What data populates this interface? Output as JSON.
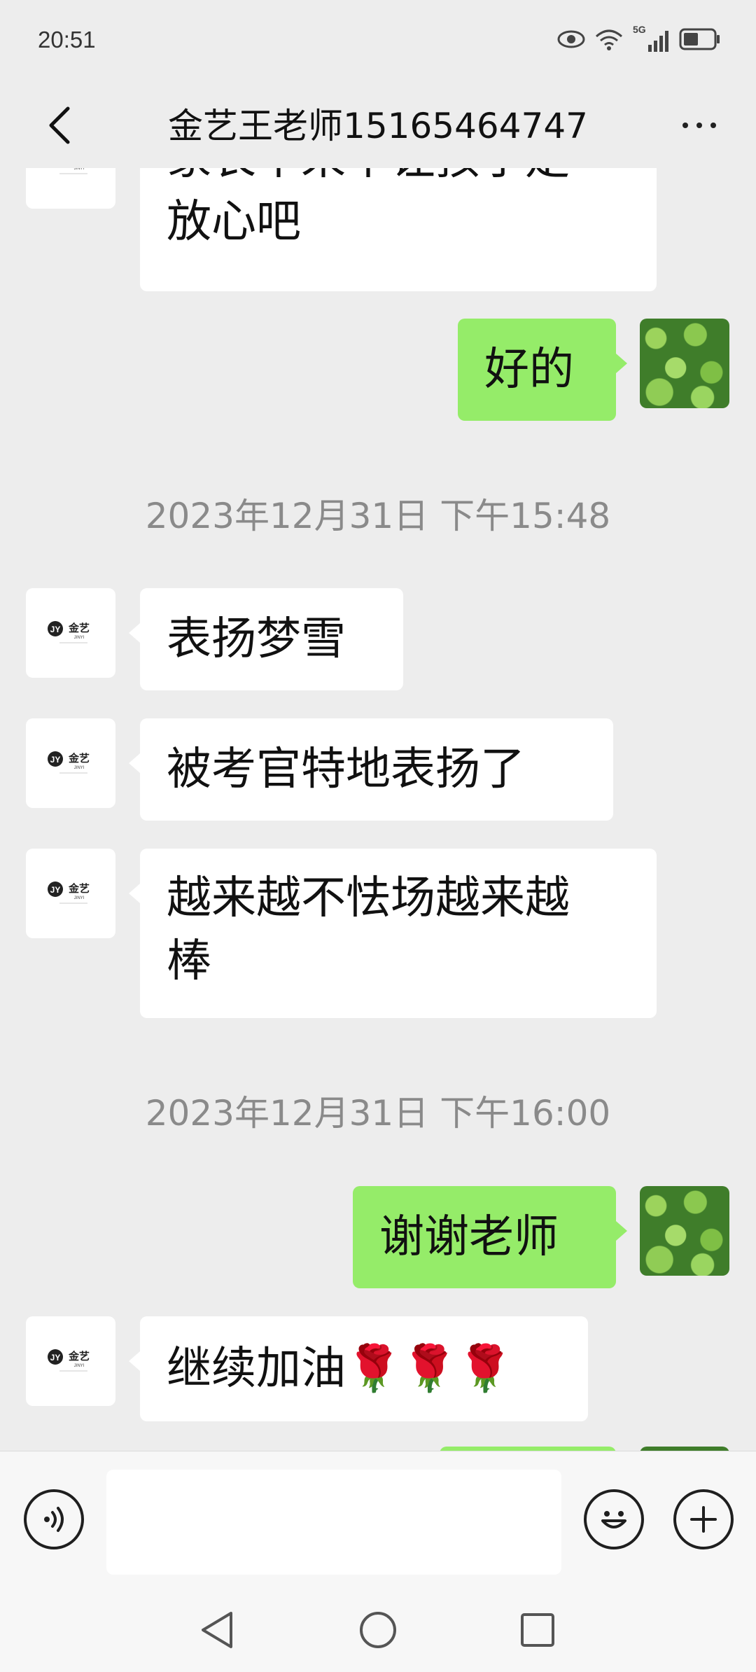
{
  "status_bar": {
    "time": "20:51",
    "network_label": "5G",
    "icons": [
      "eye-icon",
      "wifi-icon",
      "signal-icon",
      "battery-icon"
    ]
  },
  "header": {
    "title": "金艺王老师15165464747"
  },
  "messages": [
    {
      "side": "left",
      "avatar": "jinyi-logo",
      "lines": [
        "家长不来不让孩子走",
        "放心吧"
      ]
    },
    {
      "side": "right",
      "avatar": "leaf-photo",
      "lines": [
        "好的"
      ]
    },
    {
      "type": "timestamp",
      "text": "2023年12月31日 下午15:48"
    },
    {
      "side": "left",
      "avatar": "jinyi-logo",
      "lines": [
        "表扬梦雪"
      ]
    },
    {
      "side": "left",
      "avatar": "jinyi-logo",
      "lines": [
        "被考官特地表扬了"
      ]
    },
    {
      "side": "left",
      "avatar": "jinyi-logo",
      "lines": [
        "越来越不怯场越来越",
        "棒"
      ]
    },
    {
      "type": "timestamp",
      "text": "2023年12月31日 下午16:00"
    },
    {
      "side": "right",
      "avatar": "leaf-photo",
      "lines": [
        "谢谢老师"
      ]
    },
    {
      "side": "left",
      "avatar": "jinyi-logo",
      "lines": [
        "继续加油🌹🌹🌹"
      ]
    }
  ],
  "logo_text": {
    "main": "金艺",
    "sub": "JINYI"
  },
  "input": {
    "placeholder": "",
    "icons": [
      "voice-icon",
      "emoji-icon",
      "plus-icon"
    ]
  },
  "nav": {
    "icons": [
      "nav-back-icon",
      "nav-home-icon",
      "nav-recents-icon"
    ]
  },
  "colors": {
    "background": "#ededed",
    "outgoing_bubble": "#95ec69",
    "incoming_bubble": "#ffffff",
    "timestamp_text": "#8a8a8a"
  }
}
